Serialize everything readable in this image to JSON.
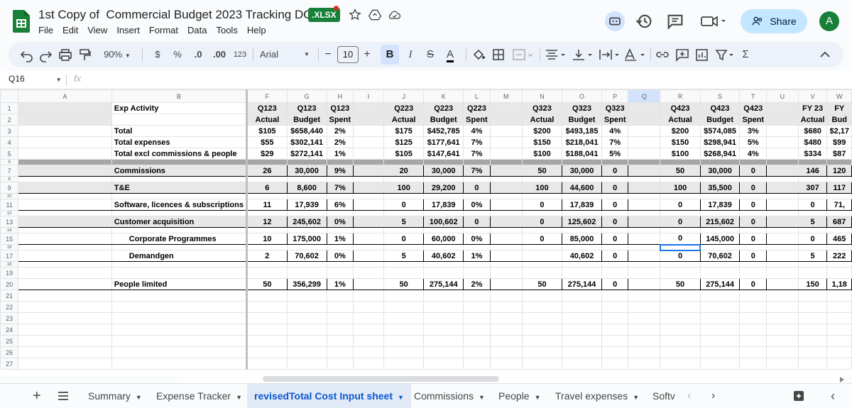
{
  "title": {
    "doc_name": "1st Copy of  Commercial Budget 2023 Tracking DOC",
    "badge": ".XLSX"
  },
  "menu": [
    "File",
    "Edit",
    "View",
    "Insert",
    "Format",
    "Data",
    "Tools",
    "Help"
  ],
  "share_label": "Share",
  "avatar_letter": "A",
  "toolbar": {
    "zoom": "90%",
    "currency": "$",
    "percent": "%",
    "dec_decrease": ".0",
    "dec_increase": ".00",
    "number_format": "123",
    "font": "Arial",
    "font_size": "10",
    "bold": "B",
    "italic": "I",
    "text_color": "A",
    "minus": "−",
    "plus": "+"
  },
  "formula_bar": {
    "cell_ref": "Q16",
    "fx": "fx"
  },
  "columns": [
    "A",
    "B",
    "F",
    "G",
    "H",
    "I",
    "J",
    "K",
    "L",
    "M",
    "N",
    "O",
    "P",
    "Q",
    "R",
    "S",
    "T",
    "U",
    "V",
    "W"
  ],
  "rows": [
    {
      "n": "1",
      "c": [
        "Exp Activity",
        "Q123",
        "Q123",
        "Q123",
        "",
        "Q223",
        "Q223",
        "Q223",
        "",
        "Q323",
        "Q323",
        "Q323",
        "",
        "Q423",
        "Q423",
        "Q423",
        "",
        "FY 23",
        "FY"
      ]
    },
    {
      "n": "2",
      "c": [
        "",
        "Actual",
        "Budget",
        "Spent",
        "",
        "Actual",
        "Budget",
        "Spent",
        "",
        "Actual",
        "Budget",
        "Spent",
        "",
        "Actual",
        "Budget",
        "Spent",
        "",
        "Actual",
        "Bud"
      ]
    },
    {
      "n": "3",
      "c": [
        "Total",
        "$105",
        "$658,440",
        "2%",
        "",
        "$175",
        "$452,785",
        "4%",
        "",
        "$200",
        "$493,185",
        "4%",
        "",
        "$200",
        "$574,085",
        "3%",
        "",
        "$680",
        "$2,17"
      ]
    },
    {
      "n": "4",
      "c": [
        "Total expenses",
        "$55",
        "$302,141",
        "2%",
        "",
        "$125",
        "$177,641",
        "7%",
        "",
        "$150",
        "$218,041",
        "7%",
        "",
        "$150",
        "$298,941",
        "5%",
        "",
        "$480",
        "$99"
      ]
    },
    {
      "n": "5",
      "c": [
        "Total excl commissions & people",
        "$29",
        "$272,141",
        "1%",
        "",
        "$105",
        "$147,641",
        "7%",
        "",
        "$100",
        "$188,041",
        "5%",
        "",
        "$100",
        "$268,941",
        "4%",
        "",
        "$334",
        "$87"
      ]
    },
    {
      "n": "6",
      "c": [
        "",
        "",
        "",
        "",
        "",
        "",
        "",
        "",
        "",
        "",
        "",
        "",
        "",
        "",
        "",
        "",
        "",
        "",
        ""
      ]
    },
    {
      "n": "7",
      "c": [
        "Commissions",
        "26",
        "30,000",
        "9%",
        "",
        "20",
        "30,000",
        "7%",
        "",
        "50",
        "30,000",
        "0",
        "",
        "50",
        "30,000",
        "0",
        "",
        "146",
        "120"
      ]
    },
    {
      "n": "8",
      "c": [
        "",
        "",
        "",
        "",
        "",
        "",
        "",
        "",
        "",
        "",
        "",
        "",
        "",
        "",
        "",
        "",
        "",
        "",
        ""
      ]
    },
    {
      "n": "9",
      "c": [
        "T&E",
        "6",
        "8,600",
        "7%",
        "",
        "100",
        "29,200",
        "0",
        "",
        "100",
        "44,600",
        "0",
        "",
        "100",
        "35,500",
        "0",
        "",
        "307",
        "117"
      ]
    },
    {
      "n": "10",
      "c": [
        "",
        "",
        "",
        "",
        "",
        "",
        "",
        "",
        "",
        "",
        "",
        "",
        "",
        "",
        "",
        "",
        "",
        "",
        ""
      ]
    },
    {
      "n": "11",
      "c": [
        "Software, licences & subscriptions",
        "11",
        "17,939",
        "6%",
        "",
        "0",
        "17,839",
        "0%",
        "",
        "0",
        "17,839",
        "0",
        "",
        "0",
        "17,839",
        "0",
        "",
        "0",
        "71,"
      ]
    },
    {
      "n": "12",
      "c": [
        "",
        "",
        "",
        "",
        "",
        "",
        "",
        "",
        "",
        "",
        "",
        "",
        "",
        "",
        "",
        "",
        "",
        "",
        ""
      ]
    },
    {
      "n": "13",
      "c": [
        "Customer acquisition",
        "12",
        "245,602",
        "0%",
        "",
        "5",
        "100,602",
        "0",
        "",
        "0",
        "125,602",
        "0",
        "",
        "0",
        "215,602",
        "0",
        "",
        "5",
        "687"
      ]
    },
    {
      "n": "14",
      "c": [
        "",
        "",
        "",
        "",
        "",
        "",
        "",
        "",
        "",
        "",
        "",
        "",
        "",
        "",
        "",
        "",
        "",
        "",
        ""
      ]
    },
    {
      "n": "15",
      "c": [
        "Corporate Programmes",
        "10",
        "175,000",
        "1%",
        "",
        "0",
        "60,000",
        "0%",
        "",
        "0",
        "85,000",
        "0",
        "",
        "0",
        "145,000",
        "0",
        "",
        "0",
        "465"
      ]
    },
    {
      "n": "16",
      "c": [
        "",
        "",
        "",
        "",
        "",
        "",
        "",
        "",
        "",
        "",
        "",
        "",
        "",
        "",
        "",
        "",
        "",
        "",
        ""
      ]
    },
    {
      "n": "17",
      "c": [
        "Demandgen",
        "2",
        "70,602",
        "0%",
        "",
        "5",
        "40,602",
        "1%",
        "",
        "",
        "40,602",
        "0",
        "",
        "0",
        "70,602",
        "0",
        "",
        "5",
        "222"
      ]
    },
    {
      "n": "18",
      "c": [
        "",
        "",
        "",
        "",
        "",
        "",
        "",
        "",
        "",
        "",
        "",
        "",
        "",
        "",
        "",
        "",
        "",
        "",
        ""
      ]
    },
    {
      "n": "19",
      "c": [
        "",
        "",
        "",
        "",
        "",
        "",
        "",
        "",
        "",
        "",
        "",
        "",
        "",
        "",
        "",
        "",
        "",
        "",
        ""
      ]
    },
    {
      "n": "20",
      "c": [
        "People limited",
        "50",
        "356,299",
        "1%",
        "",
        "50",
        "275,144",
        "2%",
        "",
        "50",
        "275,144",
        "0",
        "",
        "50",
        "275,144",
        "0",
        "",
        "150",
        "1,18"
      ]
    },
    {
      "n": "21",
      "c": [
        "",
        "",
        "",
        "",
        "",
        "",
        "",
        "",
        "",
        "",
        "",
        "",
        "",
        "",
        "",
        "",
        "",
        "",
        ""
      ]
    },
    {
      "n": "22",
      "c": [
        "",
        "",
        "",
        "",
        "",
        "",
        "",
        "",
        "",
        "",
        "",
        "",
        "",
        "",
        "",
        "",
        "",
        "",
        ""
      ]
    },
    {
      "n": "23",
      "c": [
        "",
        "",
        "",
        "",
        "",
        "",
        "",
        "",
        "",
        "",
        "",
        "",
        "",
        "",
        "",
        "",
        "",
        "",
        ""
      ]
    },
    {
      "n": "24",
      "c": [
        "",
        "",
        "",
        "",
        "",
        "",
        "",
        "",
        "",
        "",
        "",
        "",
        "",
        "",
        "",
        "",
        "",
        "",
        ""
      ]
    },
    {
      "n": "25",
      "c": [
        "",
        "",
        "",
        "",
        "",
        "",
        "",
        "",
        "",
        "",
        "",
        "",
        "",
        "",
        "",
        "",
        "",
        "",
        ""
      ]
    },
    {
      "n": "26",
      "c": [
        "",
        "",
        "",
        "",
        "",
        "",
        "",
        "",
        "",
        "",
        "",
        "",
        "",
        "",
        "",
        "",
        "",
        "",
        ""
      ]
    },
    {
      "n": "27",
      "c": [
        "",
        "",
        "",
        "",
        "",
        "",
        "",
        "",
        "",
        "",
        "",
        "",
        "",
        "",
        "",
        "",
        "",
        "",
        ""
      ]
    }
  ],
  "sheet_tabs": [
    {
      "label": "Summary",
      "active": false
    },
    {
      "label": "Expense Tracker",
      "active": false
    },
    {
      "label": "revisedTotal Cost Input sheet",
      "active": true
    },
    {
      "label": "Commissions",
      "active": false
    },
    {
      "label": "People",
      "active": false
    },
    {
      "label": "Travel expenses",
      "active": false
    },
    {
      "label": "Softv",
      "active": false
    }
  ],
  "colors": {
    "accent": "#0b57d0",
    "share_bg": "#c2e7ff",
    "sheets_green": "#188038"
  }
}
